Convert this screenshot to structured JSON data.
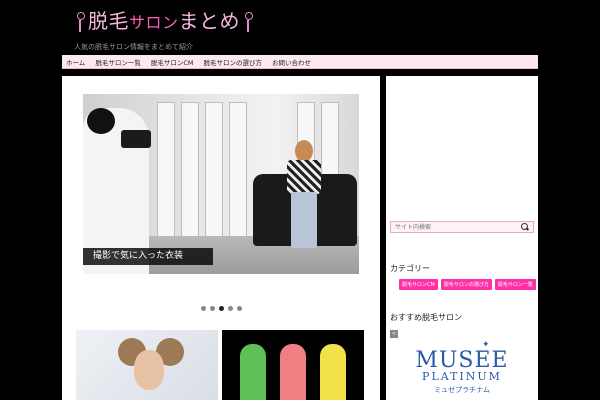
{
  "site": {
    "title_before": "脱毛",
    "title_accent": "サロン",
    "title_after": "まとめ",
    "tagline": "人気の脱毛サロン情報をまとめて紹介"
  },
  "nav": {
    "items": [
      "ホーム",
      "脱毛サロン一覧",
      "脱毛サロンCM",
      "脱毛サロンの選び方",
      "お問い合わせ"
    ]
  },
  "slider": {
    "caption": "撮影で気に入った衣装",
    "dot_count": 5,
    "active_index": 2
  },
  "sidebar": {
    "search_placeholder": "サイト内検索",
    "category_title": "カテゴリー",
    "tags": [
      "脱毛サロンCM",
      "脱毛サロンの選び方",
      "脱毛サロン一覧"
    ],
    "recommend_title": "おすすめ脱毛サロン",
    "prev_arrow": "<",
    "brand": {
      "star": "✦",
      "name": "MUSEE",
      "sub": "PLATINUM",
      "kana": "ミュゼプラチナム",
      "color": "#2a5aa8"
    }
  },
  "colors": {
    "accent_pink": "#ff2fa8",
    "nav_bg": "#fde8f2"
  }
}
